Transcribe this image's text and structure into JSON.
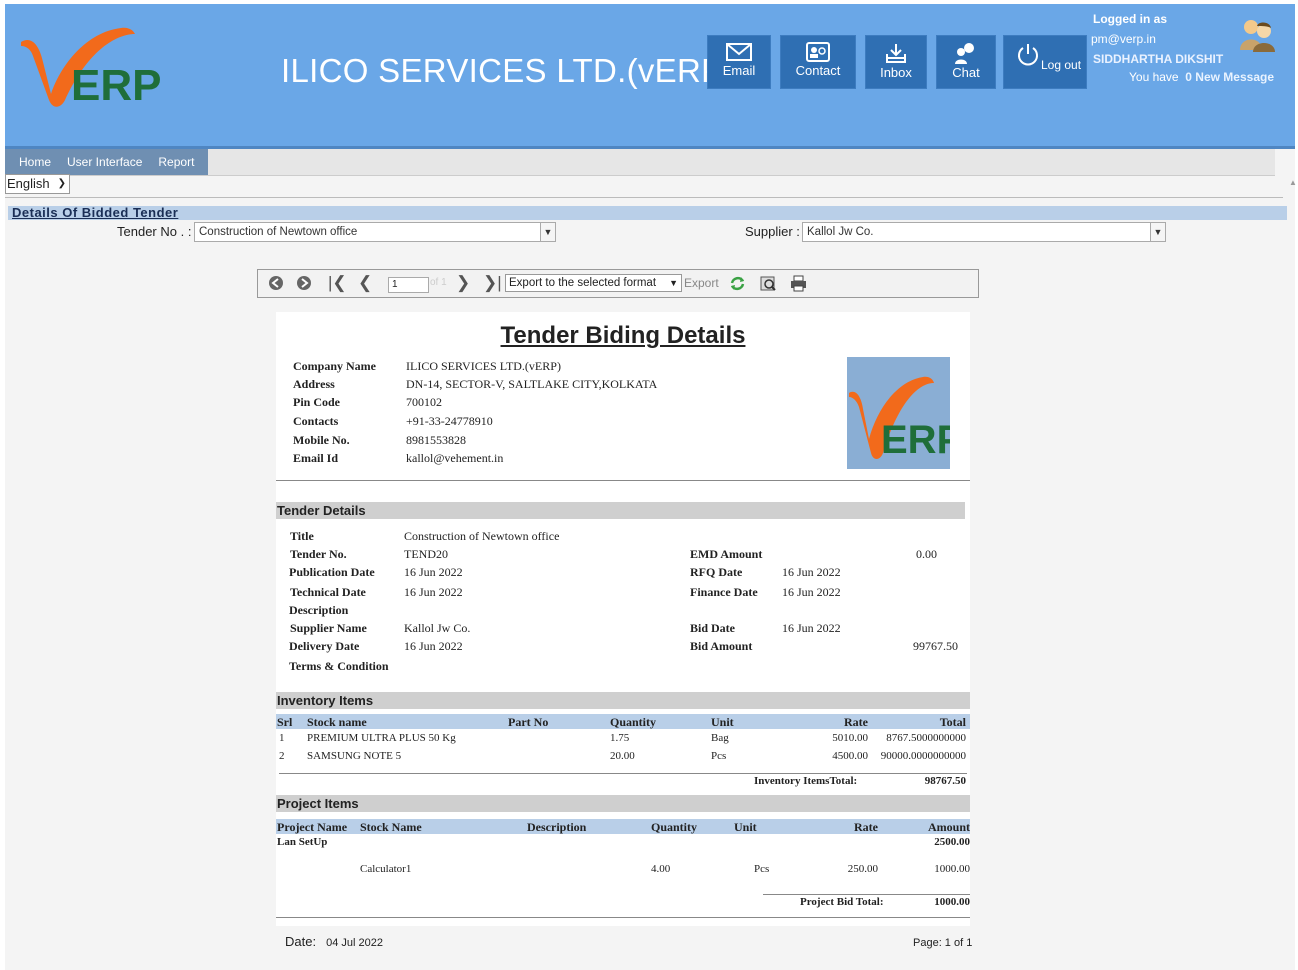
{
  "header": {
    "company_title": "ILICO SERVICES LTD.(vERP)",
    "buttons": [
      {
        "label": "Email",
        "icon": "mail-icon"
      },
      {
        "label": "Contact",
        "icon": "contact-card-icon"
      },
      {
        "label": "Inbox",
        "icon": "inbox-icon"
      },
      {
        "label": "Chat",
        "icon": "chat-icon"
      },
      {
        "label": "Log out",
        "icon": "power-icon"
      }
    ],
    "login": {
      "logged_in_as": "Logged in as",
      "email": "pm@verp.in",
      "user_name": "SIDDHARTHA DIKSHIT",
      "you_have": "You have",
      "messages": "0 New Message"
    },
    "logo_text": "ERP"
  },
  "menu": {
    "items": [
      "Home",
      "User Interface",
      "Report"
    ]
  },
  "language": {
    "selected": "English"
  },
  "section": {
    "title": "Details Of Bidded Tender"
  },
  "filters": {
    "tender_label": "Tender No . :",
    "tender_value": "Construction of Newtown office",
    "supplier_label": "Supplier :",
    "supplier_value": "Kallol Jw Co."
  },
  "toolbar": {
    "page": "1",
    "of_pages": "of 1",
    "export_format": "Export to the selected format",
    "export_label": "Export"
  },
  "report": {
    "title": "Tender Biding Details",
    "company": [
      {
        "k": "Company Name",
        "v": "ILICO SERVICES LTD.(vERP)"
      },
      {
        "k": "Address",
        "v": "DN-14, SECTOR-V, SALTLAKE CITY,KOLKATA"
      },
      {
        "k": "Pin Code",
        "v": "700102"
      },
      {
        "k": "Contacts",
        "v": "+91-33-24778910"
      },
      {
        "k": "Mobile No.",
        "v": "8981553828"
      },
      {
        "k": "Email Id",
        "v": "kallol@vehement.in"
      }
    ],
    "tender_section": "Tender Details",
    "tender": {
      "title_k": "Title",
      "title_v": "Construction of Newtown office",
      "no_k": "Tender No.",
      "no_v": "TEND20",
      "pub_k": "Publication Date",
      "pub_v": "16 Jun 2022",
      "tech_k": "Technical Date",
      "tech_v": "16 Jun 2022",
      "desc_k": "Description",
      "supp_k": "Supplier Name",
      "supp_v": "Kallol Jw Co.",
      "del_k": "Delivery Date",
      "del_v": "16 Jun 2022",
      "terms_k": "Terms & Condition",
      "emd_k": "EMD Amount",
      "emd_v": "0.00",
      "rfq_k": "RFQ Date",
      "rfq_v": "16 Jun 2022",
      "fin_k": "Finance Date",
      "fin_v": "16 Jun 2022",
      "bid_k": "Bid Date",
      "bid_v": "16 Jun 2022",
      "bamt_k": "Bid Amount",
      "bamt_v": "99767.50"
    },
    "inventory_section": "Inventory Items",
    "inventory_headers": [
      "Srl",
      "Stock name",
      "Part No",
      "Quantity",
      "Unit",
      "Rate",
      "Total"
    ],
    "inventory_rows": [
      [
        "1",
        "PREMIUM ULTRA PLUS 50 Kg",
        "",
        "1.75",
        "Bag",
        "5010.00",
        "8767.5000000000"
      ],
      [
        "2",
        "SAMSUNG NOTE 5",
        "",
        "20.00",
        "Pcs",
        "4500.00",
        "90000.0000000000"
      ]
    ],
    "inventory_total_label": "Inventory ItemsTotal:",
    "inventory_total": "98767.50",
    "project_section": "Project Items",
    "project_headers": [
      "Project Name",
      "Stock Name",
      "Description",
      "Quantity",
      "Unit",
      "Rate",
      "Amount"
    ],
    "project_group": "Lan SetUp",
    "project_group_total": "2500.00",
    "project_rows": [
      [
        "",
        "Calculator1",
        "",
        "4.00",
        "Pcs",
        "250.00",
        "1000.00"
      ]
    ],
    "project_total_label": "Project Bid Total:",
    "project_total": "1000.00"
  },
  "footer": {
    "date_label": "Date:",
    "date_value": "04 Jul 2022",
    "page": "Page: 1 of 1"
  }
}
